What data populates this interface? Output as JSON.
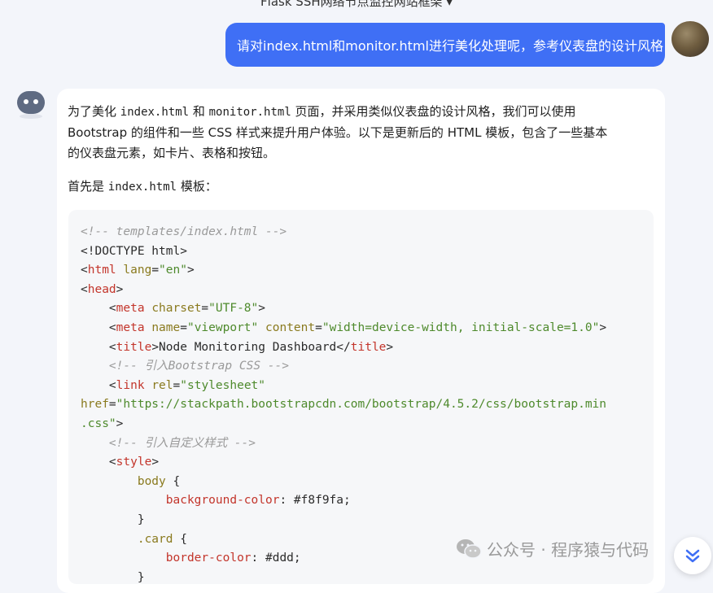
{
  "conversation": {
    "prev_title": "Flask SSH网络节点监控网站框架 ▾",
    "user_message": "请对index.html和monitor.html进行美化处理呢，参考仪表盘的设计风格",
    "assistant": {
      "intro_part1": "为了美化 ",
      "intro_code1": "index.html",
      "intro_part2": " 和 ",
      "intro_code2": "monitor.html",
      "intro_part3": " 页面，并采用类似仪表盘的设计风格，我们可以使用",
      "intro_line2": "Bootstrap 的组件和一些 CSS 样式来提升用户体验。以下是更新后的 HTML 模板，包含了一些基本",
      "intro_line3": "的仪表盘元素，如卡片、表格和按钮。",
      "first_part1": "首先是 ",
      "first_code": "index.html",
      "first_part2": " 模板："
    }
  },
  "code": {
    "l1": "<!-- templates/index.html -->",
    "l2": "<!DOCTYPE html>",
    "l3_open": "<",
    "l3_tag": "html",
    "l3_attr": "lang",
    "l3_eq": "=",
    "l3_val": "\"en\"",
    "l3_close": ">",
    "l4_open": "<",
    "l4_tag": "head",
    "l4_close": ">",
    "l5_tag": "meta",
    "l5_attr": "charset",
    "l5_val": "\"UTF-8\"",
    "l6_tag": "meta",
    "l6_attr1": "name",
    "l6_val1": "\"viewport\"",
    "l6_attr2": "content",
    "l6_val2": "\"width=device-width, initial-scale=1.0\"",
    "l7_tag": "title",
    "l7_text": "Node Monitoring Dashboard",
    "l8": "<!-- 引入Bootstrap CSS -->",
    "l9_tag": "link",
    "l9_attr": "rel",
    "l9_val": "\"stylesheet\"",
    "l10_attr": "href",
    "l10_val": "\"https://stackpath.bootstrapcdn.com/bootstrap/4.5.2/css/bootstrap.min",
    "l11_val": ".css\"",
    "l12": "<!-- 引入自定义样式 -->",
    "l13_tag": "style",
    "l14_sel": "body",
    "l14_brace": " {",
    "l15_prop": "background-color",
    "l15_val": ": #f8f9fa;",
    "l16": "}",
    "l17_sel": ".card",
    "l17_brace": " {",
    "l18_prop": "border-color",
    "l18_val": ": #ddd;",
    "l19": "}"
  },
  "watermark": {
    "text": "公众号 · 程序猿与代码"
  },
  "icons": {
    "scroll": "chevron-double-down-icon",
    "wechat": "wechat-icon"
  },
  "colors": {
    "user_bubble": "#3f6ff5",
    "background": "#f3f5fa"
  }
}
